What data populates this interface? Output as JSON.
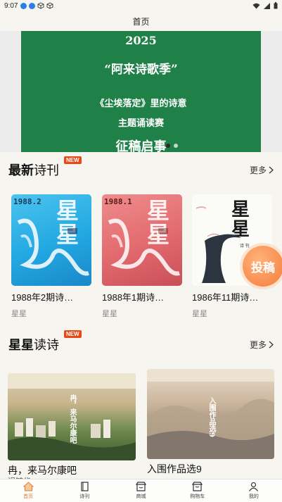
{
  "status_bar": {
    "time": "9:07"
  },
  "header": {
    "title": "首页"
  },
  "banner": {
    "year": "2025",
    "line1": "“阿来诗歌季”",
    "line2": "《尘埃落定》里的诗意",
    "line3": "主题诵读赛",
    "line4": "征稿启事"
  },
  "section_latest": {
    "title_bold": "最新",
    "title_rest": "诗刊",
    "badge": "NEW",
    "more": "更多"
  },
  "latest_books": [
    {
      "title": "1988年2期诗…",
      "author": "星星",
      "cover_year": "1988.2",
      "cover_chars": "星星"
    },
    {
      "title": "1988年1期诗…",
      "author": "星星",
      "cover_year": "1988.1",
      "cover_chars": "星星"
    },
    {
      "title": "1986年11期诗…",
      "author": "星星",
      "cover_chars": "星星",
      "cover_sub": "诗 刊"
    }
  ],
  "submit_button": {
    "label": "投稿"
  },
  "section_read": {
    "title_bold": "星星",
    "title_rest": "读诗",
    "badge": "NEW",
    "more": "更多"
  },
  "read_items": [
    {
      "title": "冉，来马尔康吧",
      "subtitle": "迟毓华",
      "overlay_text": "冉，来马尔康吧"
    },
    {
      "title": "入围作品选9",
      "overlay_text": "入围作品选9"
    }
  ],
  "tabs": [
    {
      "label": "首页",
      "icon": "home-icon",
      "active": true
    },
    {
      "label": "诗刊",
      "icon": "book-icon",
      "active": false
    },
    {
      "label": "商城",
      "icon": "shop-icon",
      "active": false
    },
    {
      "label": "购物车",
      "icon": "cart-icon",
      "active": false
    },
    {
      "label": "我的",
      "icon": "user-icon",
      "active": false
    }
  ],
  "colors": {
    "accent": "#e07a2f",
    "banner_green": "#1f8048",
    "badge_red": "#e64a19"
  }
}
